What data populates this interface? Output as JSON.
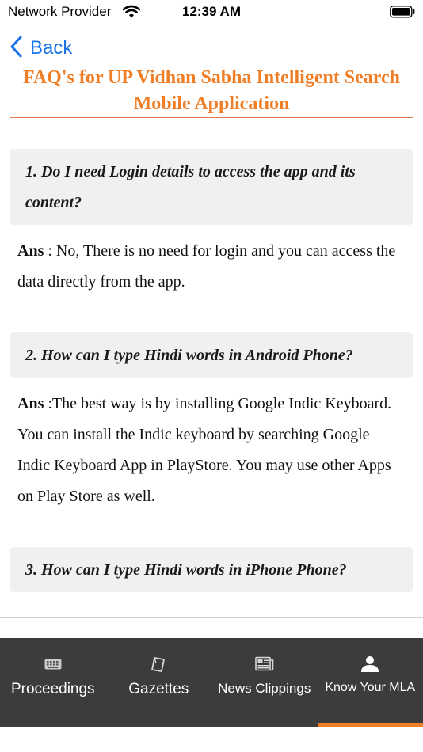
{
  "status_bar": {
    "carrier": "Network Provider",
    "time": "12:39 AM"
  },
  "nav": {
    "back_label": "Back"
  },
  "page": {
    "title": "FAQ's for UP Vidhan Sabha Intelligent Search Mobile Application"
  },
  "faqs": [
    {
      "question": "1. Do I need Login details to access the app and its content?",
      "answer_label": "Ans",
      "answer": " : No, There is no need for login and you can access the data directly from the app."
    },
    {
      "question": "2. How can I type Hindi words in Android Phone?",
      "answer_label": "Ans",
      "answer": " :The best way is by installing Google Indic Keyboard. You can install the Indic keyboard by searching Google Indic Keyboard App in PlayStore. You may use other Apps on Play Store as well."
    },
    {
      "question": "3. How can I type Hindi words in iPhone Phone?",
      "answer_label": "",
      "answer": ""
    }
  ],
  "tab_bar": {
    "active_color": "#f07e26",
    "tabs": [
      {
        "label": "Proceedings",
        "icon": "keyboard-icon",
        "active": false
      },
      {
        "label": "Gazettes",
        "icon": "document-icon",
        "active": false
      },
      {
        "label": "News Clippings",
        "icon": "newspaper-icon",
        "active": false
      },
      {
        "label": "Know Your MLA",
        "icon": "person-icon",
        "active": true
      }
    ]
  }
}
